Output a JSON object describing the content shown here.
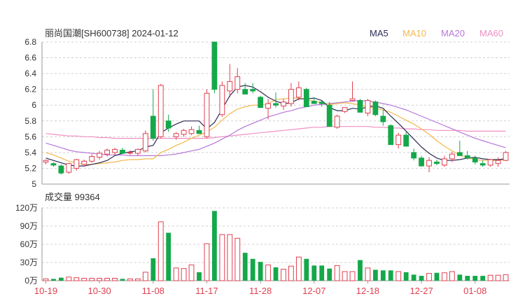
{
  "header": {
    "title": "丽尚国潮[SH600738] 2024-01-12"
  },
  "legend": [
    {
      "label": "MA5",
      "color": "#2b2b55"
    },
    {
      "label": "MA10",
      "color": "#f2b84b"
    },
    {
      "label": "MA20",
      "color": "#b777d9"
    },
    {
      "label": "MA60",
      "color": "#f08fc4"
    }
  ],
  "volume_panel": {
    "label": "成交量 99364"
  },
  "colors": {
    "up": "#e04050",
    "down": "#14a84a",
    "grid": "#d0d0d0",
    "axis_text": "#333333",
    "date_text": "#e04050"
  },
  "chart_data": [
    {
      "type": "candlestick",
      "title": "丽尚国潮[SH600738] 2024-01-12",
      "ylim": [
        5,
        6.8
      ],
      "yticks": [
        5,
        5.2,
        5.4,
        5.6,
        5.8,
        6,
        6.2,
        6.4,
        6.6,
        6.8
      ],
      "x_tick_labels": [
        "10-19",
        "10-30",
        "11-08",
        "11-17",
        "11-28",
        "12-07",
        "12-18",
        "12-27",
        "01-08"
      ],
      "x_tick_index": [
        0,
        7,
        14,
        21,
        28,
        35,
        42,
        49,
        56
      ],
      "ohlc": [
        [
          5.28,
          5.31,
          5.25,
          5.3
        ],
        [
          5.26,
          5.28,
          5.22,
          5.24
        ],
        [
          5.23,
          5.25,
          5.12,
          5.14
        ],
        [
          5.15,
          5.27,
          5.13,
          5.26
        ],
        [
          5.2,
          5.32,
          5.17,
          5.31
        ],
        [
          5.25,
          5.31,
          5.23,
          5.29
        ],
        [
          5.29,
          5.38,
          5.27,
          5.35
        ],
        [
          5.34,
          5.42,
          5.31,
          5.39
        ],
        [
          5.38,
          5.45,
          5.35,
          5.43
        ],
        [
          5.4,
          5.46,
          5.36,
          5.44
        ],
        [
          5.43,
          5.46,
          5.38,
          5.39
        ],
        [
          5.4,
          5.43,
          5.37,
          5.4
        ],
        [
          5.39,
          5.45,
          5.36,
          5.44
        ],
        [
          5.42,
          5.68,
          5.4,
          5.64
        ],
        [
          5.86,
          6.2,
          5.55,
          5.58
        ],
        [
          5.6,
          6.27,
          5.58,
          6.25
        ],
        [
          5.8,
          5.88,
          5.66,
          5.71
        ],
        [
          5.6,
          5.66,
          5.56,
          5.64
        ],
        [
          5.63,
          5.7,
          5.6,
          5.68
        ],
        [
          5.64,
          5.73,
          5.62,
          5.69
        ],
        [
          5.68,
          5.74,
          5.64,
          5.64
        ],
        [
          5.6,
          6.2,
          5.58,
          6.15
        ],
        [
          6.8,
          6.8,
          6.15,
          6.2
        ],
        [
          5.88,
          6.3,
          5.85,
          6.25
        ],
        [
          6.18,
          6.52,
          6.1,
          6.3
        ],
        [
          6.2,
          6.47,
          6.15,
          6.36
        ],
        [
          6.2,
          6.28,
          6.14,
          6.14
        ],
        [
          6.2,
          6.28,
          6.15,
          6.18
        ],
        [
          6.1,
          6.12,
          5.97,
          5.97
        ],
        [
          5.96,
          6.08,
          5.82,
          6.02
        ],
        [
          6.02,
          6.16,
          5.97,
          6.0
        ],
        [
          5.99,
          6.08,
          5.94,
          6.04
        ],
        [
          6.02,
          6.28,
          5.98,
          6.2
        ],
        [
          6.1,
          6.3,
          6.06,
          6.22
        ],
        [
          6.2,
          6.22,
          5.98,
          5.98
        ],
        [
          6.05,
          6.1,
          6.02,
          6.02
        ],
        [
          6.04,
          6.06,
          5.98,
          6.02
        ],
        [
          6.0,
          6.04,
          5.73,
          5.73
        ],
        [
          5.72,
          5.88,
          5.7,
          5.86
        ],
        [
          5.92,
          5.97,
          5.9,
          5.97
        ],
        [
          6.06,
          6.3,
          6.05,
          6.08
        ],
        [
          6.06,
          6.08,
          5.91,
          5.91
        ],
        [
          5.9,
          6.08,
          5.86,
          6.06
        ],
        [
          6.04,
          6.06,
          5.86,
          5.88
        ],
        [
          5.86,
          5.94,
          5.74,
          5.79
        ],
        [
          5.74,
          5.76,
          5.5,
          5.5
        ],
        [
          5.5,
          5.65,
          5.45,
          5.62
        ],
        [
          5.62,
          5.66,
          5.48,
          5.48
        ],
        [
          5.4,
          5.45,
          5.3,
          5.33
        ],
        [
          5.33,
          5.36,
          5.22,
          5.23
        ],
        [
          5.23,
          5.34,
          5.15,
          5.3
        ],
        [
          5.28,
          5.31,
          5.24,
          5.26
        ],
        [
          5.24,
          5.36,
          5.22,
          5.32
        ],
        [
          5.32,
          5.41,
          5.28,
          5.38
        ],
        [
          5.4,
          5.55,
          5.36,
          5.36
        ],
        [
          5.36,
          5.42,
          5.31,
          5.33
        ],
        [
          5.33,
          5.36,
          5.25,
          5.28
        ],
        [
          5.26,
          5.3,
          5.22,
          5.24
        ],
        [
          5.24,
          5.32,
          5.22,
          5.31
        ],
        [
          5.26,
          5.34,
          5.22,
          5.3
        ],
        [
          5.3,
          5.42,
          5.29,
          5.4
        ]
      ],
      "ma5": [
        5.33,
        5.3,
        5.27,
        5.24,
        5.23,
        5.23,
        5.25,
        5.27,
        5.3,
        5.36,
        5.39,
        5.41,
        5.42,
        5.47,
        5.49,
        5.65,
        5.71,
        5.76,
        5.8,
        5.8,
        5.8,
        5.7,
        5.78,
        5.95,
        6.12,
        6.23,
        6.25,
        6.23,
        6.17,
        6.1,
        6.05,
        6.02,
        6.03,
        6.08,
        6.08,
        6.09,
        6.06,
        5.97,
        5.93,
        5.93,
        5.96,
        5.95,
        5.98,
        5.99,
        5.96,
        5.86,
        5.77,
        5.67,
        5.57,
        5.47,
        5.39,
        5.33,
        5.3,
        5.3,
        5.31,
        5.33,
        5.34,
        5.32,
        5.31,
        5.31,
        5.32
      ],
      "ma10": [
        5.4,
        5.37,
        5.33,
        5.29,
        5.27,
        5.25,
        5.25,
        5.26,
        5.27,
        5.28,
        5.3,
        5.31,
        5.31,
        5.32,
        5.32,
        5.4,
        5.44,
        5.49,
        5.53,
        5.58,
        5.62,
        5.66,
        5.72,
        5.81,
        5.89,
        5.95,
        5.98,
        6.0,
        6.0,
        6.02,
        6.07,
        6.08,
        6.09,
        6.09,
        6.07,
        6.05,
        6.03,
        6.01,
        6.02,
        6.03,
        6.02,
        6.0,
        5.98,
        5.96,
        5.94,
        5.91,
        5.86,
        5.81,
        5.76,
        5.7,
        5.63,
        5.55,
        5.48,
        5.42,
        5.37,
        5.33,
        5.31,
        5.3,
        5.3,
        5.3,
        5.31
      ],
      "ma20": [
        5.52,
        5.49,
        5.46,
        5.43,
        5.41,
        5.4,
        5.39,
        5.38,
        5.37,
        5.37,
        5.37,
        5.36,
        5.36,
        5.36,
        5.36,
        5.36,
        5.37,
        5.38,
        5.4,
        5.42,
        5.44,
        5.48,
        5.52,
        5.57,
        5.62,
        5.68,
        5.73,
        5.77,
        5.81,
        5.85,
        5.88,
        5.91,
        5.93,
        5.96,
        5.98,
        6.0,
        6.01,
        6.02,
        6.03,
        6.04,
        6.05,
        6.06,
        6.05,
        6.04,
        6.02,
        6.0,
        5.97,
        5.94,
        5.9,
        5.86,
        5.82,
        5.78,
        5.74,
        5.7,
        5.66,
        5.62,
        5.58,
        5.55,
        5.52,
        5.49,
        5.46
      ],
      "ma60": [
        5.64,
        5.63,
        5.62,
        5.61,
        5.61,
        5.6,
        5.6,
        5.59,
        5.59,
        5.58,
        5.58,
        5.58,
        5.58,
        5.58,
        5.58,
        5.58,
        5.58,
        5.58,
        5.58,
        5.58,
        5.58,
        5.58,
        5.59,
        5.6,
        5.61,
        5.62,
        5.63,
        5.64,
        5.65,
        5.66,
        5.67,
        5.68,
        5.69,
        5.7,
        5.71,
        5.72,
        5.72,
        5.73,
        5.73,
        5.73,
        5.73,
        5.73,
        5.73,
        5.72,
        5.72,
        5.71,
        5.71,
        5.7,
        5.7,
        5.69,
        5.69,
        5.68,
        5.68,
        5.68,
        5.68,
        5.67,
        5.67,
        5.67,
        5.67,
        5.67,
        5.67
      ]
    },
    {
      "type": "bar",
      "title": "成交量 99364",
      "ylim": [
        0,
        120
      ],
      "ytick_values": [
        0,
        30,
        60,
        90,
        120
      ],
      "ytick_labels": [
        "0万",
        "30万",
        "60万",
        "90万",
        "120万"
      ],
      "volume": [
        3,
        3,
        5,
        6,
        5,
        4,
        4,
        4,
        4,
        4,
        3,
        3,
        3,
        14,
        37,
        97,
        79,
        21,
        20,
        26,
        14,
        61,
        115,
        76,
        76,
        70,
        46,
        36,
        31,
        26,
        22,
        19,
        24,
        39,
        36,
        25,
        25,
        20,
        25,
        15,
        15,
        34,
        21,
        18,
        17,
        17,
        15,
        14,
        10,
        8,
        12,
        13,
        13,
        15,
        10,
        8,
        8,
        8,
        9,
        9,
        10
      ]
    }
  ]
}
